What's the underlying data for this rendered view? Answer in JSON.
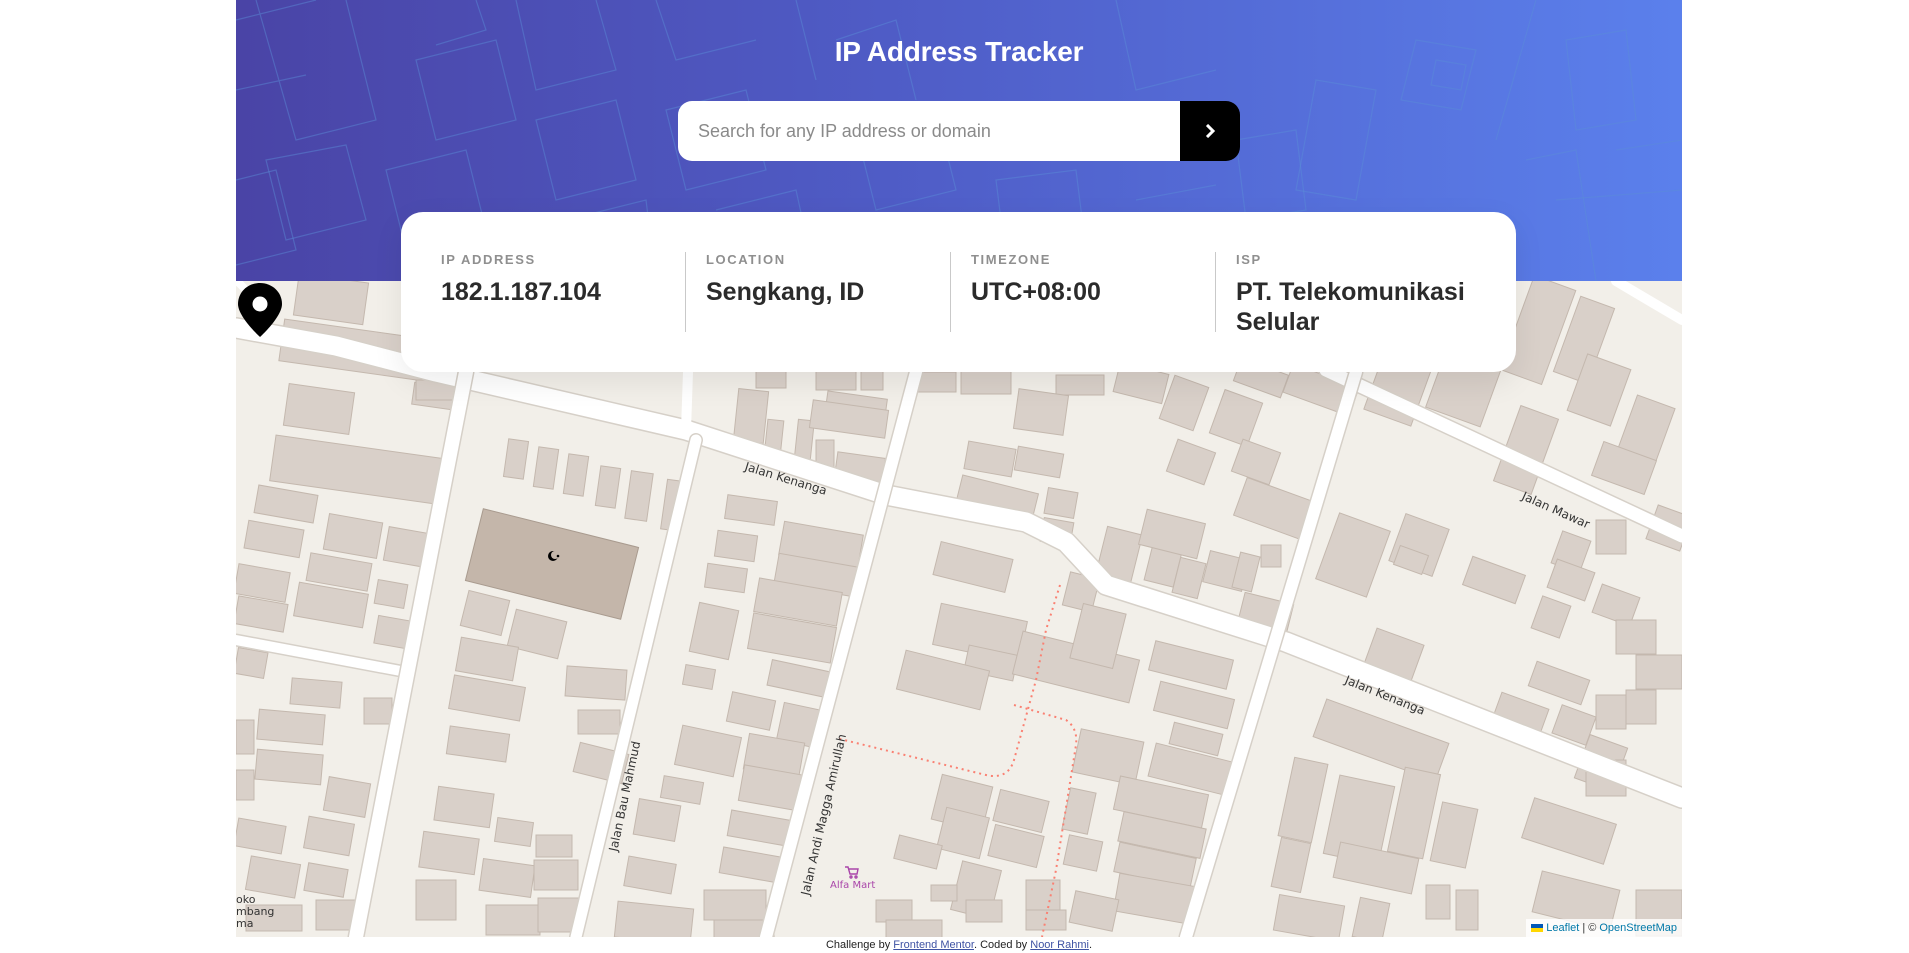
{
  "header": {
    "title": "IP Address Tracker"
  },
  "search": {
    "placeholder": "Search for any IP address or domain",
    "value": "",
    "button_icon": "chevron-right-icon"
  },
  "info": {
    "ip": {
      "label": "IP ADDRESS",
      "value": "182.1.187.104"
    },
    "location": {
      "label": "LOCATION",
      "value": "Sengkang, ID"
    },
    "timezone": {
      "label": "TIMEZONE",
      "value": "UTC+08:00"
    },
    "isp": {
      "label": "ISP",
      "value": "PT. Telekomunikasi Selular"
    }
  },
  "map": {
    "streets": {
      "kenanga_1": "Jalan Kenanga",
      "kenanga_2": "Jalan Kenanga",
      "mawar": "Jalan Mawar",
      "bau_mahmud": "Jalan Bau Mahmud",
      "andi_magga": "Jalan Andi Magga Amirullah"
    },
    "poi": {
      "alfa_mart": "Alfa Mart",
      "edge_text_1": "oko",
      "edge_text_2": "mbang",
      "edge_text_3": "ma"
    },
    "marker_icon": "location-pin-icon",
    "mosque_icon": "crescent-star-icon",
    "attribution": {
      "leaflet": "Leaflet",
      "separator": " | © ",
      "osm": "OpenStreetMap"
    }
  },
  "footer": {
    "prefix": "Challenge by ",
    "frontend_mentor": "Frontend Mentor",
    "middle": ". Coded by ",
    "author": "Noor Rahmi",
    "suffix": "."
  },
  "colors": {
    "header_start": "#4a44a6",
    "header_end": "#5b80ec",
    "map_bg": "#f2efe9",
    "building": "#d9d0c9",
    "road": "#ffffff",
    "path": "#fa8072",
    "marker": "#000000"
  }
}
